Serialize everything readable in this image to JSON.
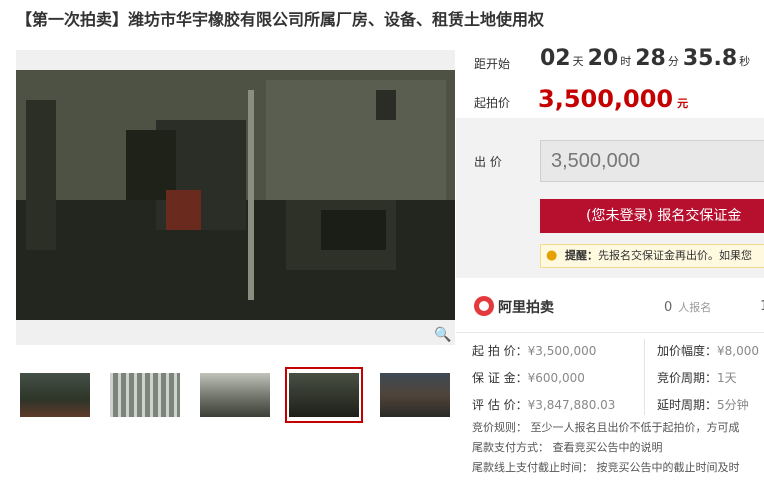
{
  "title": "【第一次拍卖】潍坊市华宇橡胶有限公司所属厂房、设备、租赁土地使用权",
  "countdown": {
    "label": "距开始",
    "days": "02",
    "days_unit": "天",
    "hours": "20",
    "hours_unit": "时",
    "minutes": "28",
    "minutes_unit": "分",
    "seconds": "35.8",
    "seconds_unit": "秒"
  },
  "start_price": {
    "label": "起拍价",
    "value": "3,500,000",
    "currency": "元"
  },
  "bid": {
    "label": "出 价",
    "input_value": "3,500,000",
    "register_button": "(您未登录) 报名交保证金",
    "tip_label": "提醒：",
    "tip_text": "先报名交保证金再出价。如果您"
  },
  "platform": {
    "name": "阿里拍卖",
    "registrants": "0",
    "registrants_unit": "人报名",
    "next_stat": "1"
  },
  "details": {
    "start_price_label": "起 拍 价：",
    "start_price_value": "¥3,500,000",
    "deposit_label": "保 证 金：",
    "deposit_value": "¥600,000",
    "appraisal_label": "评 估 价：",
    "appraisal_value": "¥3,847,880.03",
    "increment_label": "加价幅度：",
    "increment_value": "¥8,000",
    "cycle_label": "竞价周期：",
    "cycle_value": "1天",
    "delay_label": "延时周期：",
    "delay_value": "5分钟"
  },
  "rules": {
    "rule_label": "竞价规则：",
    "rule_text": "至少一人报名且出价不低于起拍价，方可成",
    "payment_label": "尾款支付方式：",
    "payment_text": "查看竞买公告中的说明",
    "deadline_label": "尾款线上支付截止时间：",
    "deadline_text": "按竞买公告中的截止时间及时"
  },
  "zoom_icon": "magnifier-icon",
  "colors": {
    "accent_red": "#c40000",
    "button_red": "#b7102f",
    "tip_bg": "#fff9e0"
  }
}
